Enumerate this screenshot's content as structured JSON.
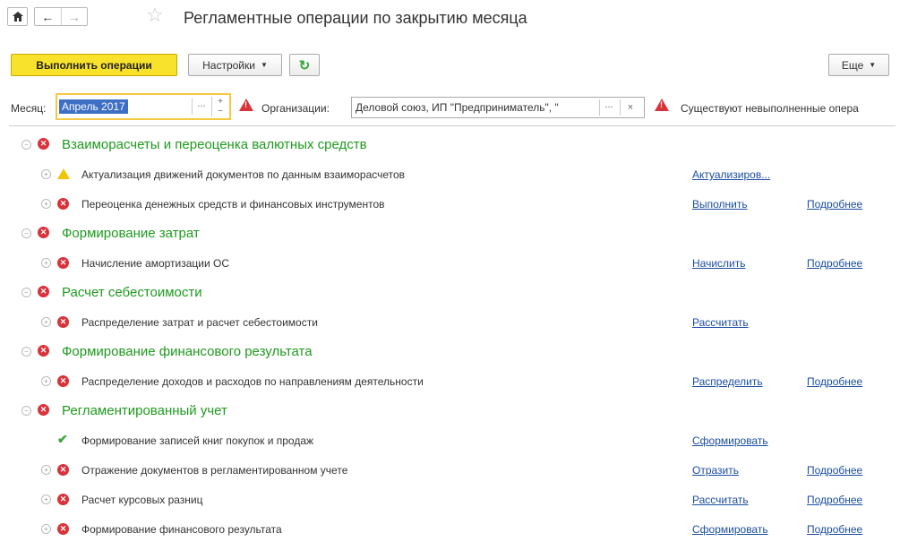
{
  "header": {
    "title": "Регламентные операции по закрытию месяца"
  },
  "toolbar": {
    "run_label": "Выполнить операции",
    "settings_label": "Настройки",
    "more_label": "Еще"
  },
  "filters": {
    "month_label": "Месяц:",
    "month_value": "Апрель 2017",
    "org_label": "Организации:",
    "org_value": "Деловой союз, ИП \"Предприниматель\", \"",
    "ellipsis": "...",
    "warning_text": "Существуют невыполненные опера"
  },
  "colors": {
    "group_green": "#1e9a1e",
    "error_red": "#d9323a",
    "warning_yellow": "#f5c400",
    "link_blue": "#1b4ea0",
    "ok_green": "#3aa63a"
  },
  "operations": [
    {
      "type": "group",
      "status": "error",
      "label": "Взаиморасчеты и переоценка валютных средств"
    },
    {
      "type": "item",
      "status": "warning",
      "label": "Актуализация движений документов по данным взаиморасчетов",
      "action": "Актуализиров...",
      "details": ""
    },
    {
      "type": "item",
      "status": "error",
      "label": "Переоценка денежных средств и финансовых инструментов",
      "action": "Выполнить",
      "details": "Подробнее"
    },
    {
      "type": "group",
      "status": "error",
      "label": "Формирование затрат"
    },
    {
      "type": "item",
      "status": "error",
      "label": "Начисление амортизации ОС",
      "action": "Начислить",
      "details": "Подробнее"
    },
    {
      "type": "group",
      "status": "error",
      "label": "Расчет себестоимости"
    },
    {
      "type": "item",
      "status": "error",
      "label": "Распределение затрат и расчет себестоимости",
      "action": "Рассчитать",
      "details": ""
    },
    {
      "type": "group",
      "status": "error",
      "label": "Формирование финансового результата"
    },
    {
      "type": "item",
      "status": "error",
      "label": "Распределение доходов и расходов по направлениям деятельности",
      "action": "Распределить",
      "details": "Подробнее"
    },
    {
      "type": "group",
      "status": "error",
      "label": "Регламентированный учет"
    },
    {
      "type": "item",
      "status": "ok",
      "label": "Формирование записей книг покупок и продаж",
      "action": "Сформировать",
      "details": ""
    },
    {
      "type": "item",
      "status": "error",
      "label": "Отражение документов в регламентированном учете",
      "action": "Отразить",
      "details": "Подробнее"
    },
    {
      "type": "item",
      "status": "error",
      "label": "Расчет курсовых разниц",
      "action": "Рассчитать",
      "details": "Подробнее"
    },
    {
      "type": "item",
      "status": "error",
      "label": "Формирование финансового результата",
      "action": "Сформировать",
      "details": "Подробнее"
    }
  ]
}
